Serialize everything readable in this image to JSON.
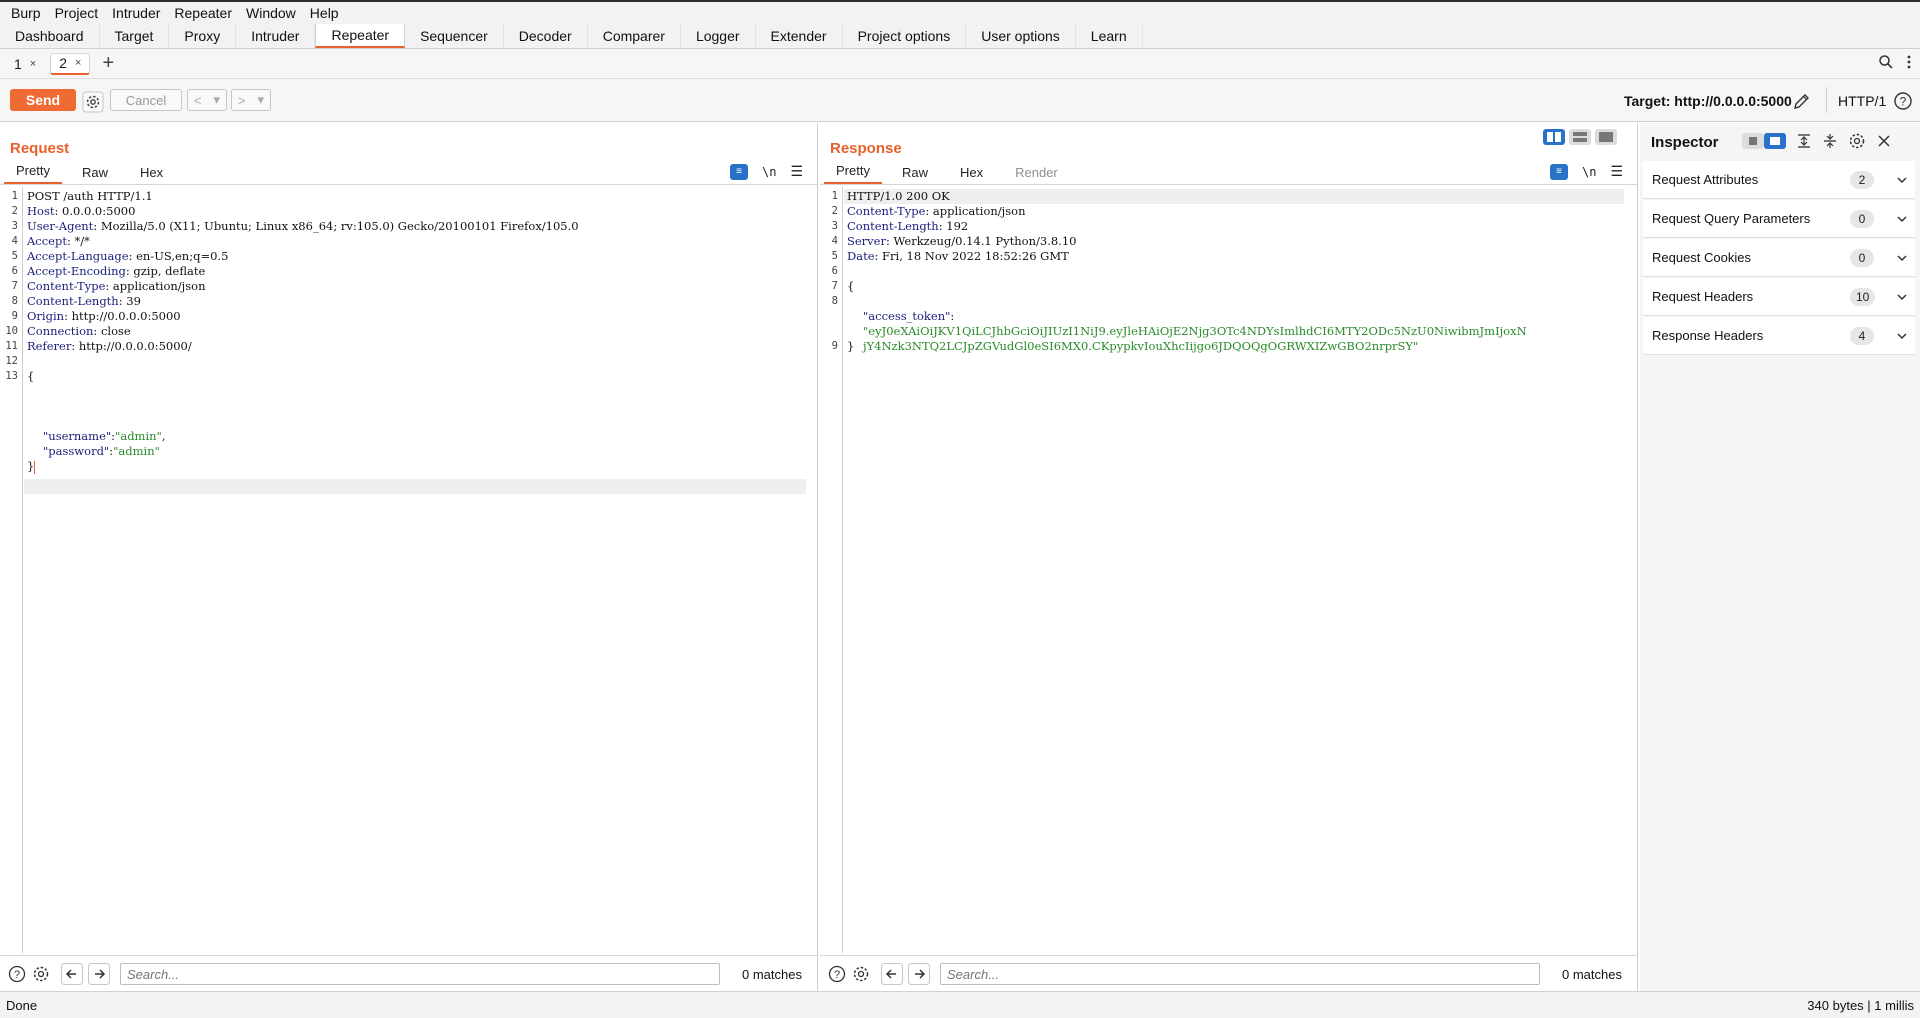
{
  "menubar": [
    "Burp",
    "Project",
    "Intruder",
    "Repeater",
    "Window",
    "Help"
  ],
  "main_tabs": [
    "Dashboard",
    "Target",
    "Proxy",
    "Intruder",
    "Repeater",
    "Sequencer",
    "Decoder",
    "Comparer",
    "Logger",
    "Extender",
    "Project options",
    "User options",
    "Learn"
  ],
  "active_main_tab": "Repeater",
  "sub_tabs": [
    {
      "label": "1",
      "close": "×"
    },
    {
      "label": "2",
      "close": "×"
    }
  ],
  "new_tab": "+",
  "toolbar": {
    "send": "Send",
    "cancel": "Cancel",
    "back": "<",
    "forward": ">",
    "dropdown": "▾",
    "target": "Target: http://0.0.0.0:5000",
    "http_version": "HTTP/1"
  },
  "request": {
    "title": "Request",
    "tabs": [
      "Pretty",
      "Raw",
      "Hex"
    ],
    "newline_icon": "\\n",
    "lines": [
      {
        "n": "1",
        "name": "",
        "value": "POST /auth HTTP/1.1"
      },
      {
        "n": "2",
        "name": "Host",
        "value": " 0.0.0.0:5000"
      },
      {
        "n": "3",
        "name": "User-Agent",
        "value": " Mozilla/5.0 (X11; Ubuntu; Linux x86_64; rv:105.0) Gecko/20100101 Firefox/105.0"
      },
      {
        "n": "4",
        "name": "Accept",
        "value": " */*"
      },
      {
        "n": "5",
        "name": "Accept-Language",
        "value": " en-US,en;q=0.5"
      },
      {
        "n": "6",
        "name": "Accept-Encoding",
        "value": " gzip, deflate"
      },
      {
        "n": "7",
        "name": "Content-Type",
        "value": " application/json"
      },
      {
        "n": "8",
        "name": "Content-Length",
        "value": " 39"
      },
      {
        "n": "9",
        "name": "Origin",
        "value": " http://0.0.0.0:5000"
      },
      {
        "n": "10",
        "name": "Connection",
        "value": " close"
      },
      {
        "n": "11",
        "name": "Referer",
        "value": " http://0.0.0.0:5000/"
      },
      {
        "n": "12",
        "name": "",
        "value": ""
      },
      {
        "n": "13",
        "name": "",
        "value": "{"
      }
    ],
    "body": [
      {
        "key": "\"username\"",
        "sep": ":",
        "val": "\"admin\"",
        "tail": ","
      },
      {
        "key": "\"password\"",
        "sep": ":",
        "val": "\"admin\"",
        "tail": ""
      }
    ],
    "body_close": "}",
    "search_placeholder": "Search...",
    "matches": "0 matches"
  },
  "response": {
    "title": "Response",
    "tabs": [
      "Pretty",
      "Raw",
      "Hex",
      "Render"
    ],
    "newline_icon": "\\n",
    "lines": [
      {
        "n": "1",
        "name": "",
        "value": "HTTP/1.0 200 OK"
      },
      {
        "n": "2",
        "name": "Content-Type",
        "value": " application/json"
      },
      {
        "n": "3",
        "name": "Content-Length",
        "value": " 192"
      },
      {
        "n": "4",
        "name": "Server",
        "value": " Werkzeug/0.14.1 Python/3.8.10"
      },
      {
        "n": "5",
        "name": "Date",
        "value": " Fri, 18 Nov 2022 18:52:26 GMT"
      },
      {
        "n": "6",
        "name": "",
        "value": ""
      },
      {
        "n": "7",
        "name": "",
        "value": "{"
      },
      {
        "n": "8",
        "name": "",
        "value": ""
      },
      {
        "n": "9",
        "name": "",
        "value": "}"
      }
    ],
    "token_key": "\"access_token\"",
    "token_sep": ":",
    "token_line1": "\"eyJ0eXAiOiJKV1QiLCJhbGciOiJIUzI1NiJ9.eyJleHAiOjE2Njg3OTc4NDYsImlhdCI6MTY2ODc5NzU0NiwibmJmIjoxN",
    "token_line2": "jY4Nzk3NTQ2LCJpZGVudGl0eSI6MX0.CKpypkvIouXhcIijgo6JDQOQgOGRWXIZwGBO2nrprSY\"",
    "search_placeholder": "Search...",
    "matches": "0 matches"
  },
  "inspector": {
    "title": "Inspector",
    "rows": [
      {
        "label": "Request Attributes",
        "count": "2"
      },
      {
        "label": "Request Query Parameters",
        "count": "0"
      },
      {
        "label": "Request Cookies",
        "count": "0"
      },
      {
        "label": "Request Headers",
        "count": "10"
      },
      {
        "label": "Response Headers",
        "count": "4"
      }
    ]
  },
  "status": {
    "left": "Done",
    "right": "340 bytes | 1 millis"
  },
  "colors": {
    "accent": "#e8612c",
    "send": "#f06a33",
    "header_name": "#1a1f7a",
    "json_string": "#2a8a2a",
    "toggle_active": "#2a72c9"
  },
  "icons": [
    "search-icon",
    "kebab-menu-icon",
    "gear-icon",
    "pencil-icon",
    "help-icon",
    "wrap-icon",
    "hamburger-icon",
    "arrow-left-icon",
    "arrow-right-icon",
    "chevron-down-icon",
    "close-icon",
    "layout-icon"
  ]
}
